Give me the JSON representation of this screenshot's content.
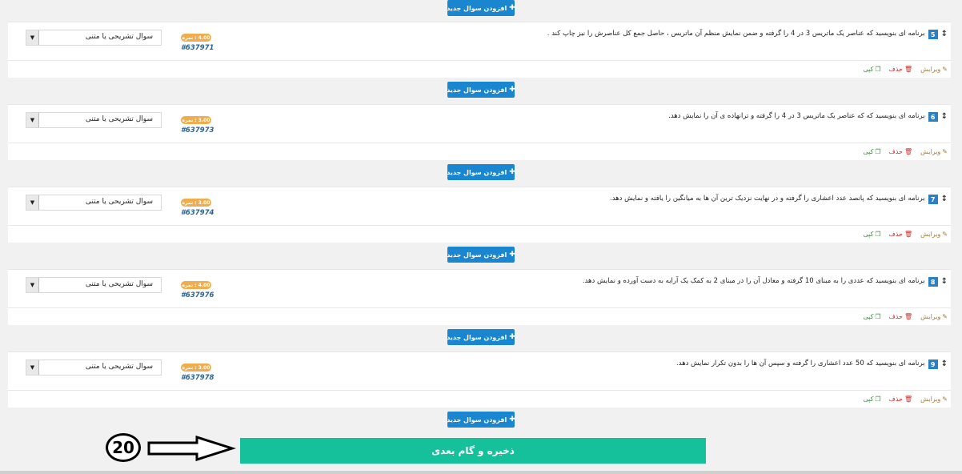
{
  "add_button_label": "افزودن سوال جدید",
  "questions": [
    {
      "number": "5",
      "text": "برنامه ای بنویسید که عناصر یک ماتریس 3 در 4 را گرفته و ضمن نمایش منظم آن ماتریس ، حاصل جمع کل عناصرش را نیز چاپ کند .",
      "score": "4.00 : نمره",
      "id": "#637971",
      "type": "سوال تشریحی یا متنی"
    },
    {
      "number": "6",
      "text": "برنامه ای بنویسید که که عناصر یک ماتریس 3 در 4 را گرفته و ترانهاده ی آن را نمایش دهد.",
      "score": "3.00 : نمره",
      "id": "#637973",
      "type": "سوال تشریحی یا متنی"
    },
    {
      "number": "7",
      "text": "برنامه ای بنویسید که پانصد عدد اعشاری را گرفته و در نهایت نزدیک ترین آن ها به میانگین را یافته و نمایش دهد.",
      "score": "3.00 : نمره",
      "id": "#637974",
      "type": "سوال تشریحی یا متنی"
    },
    {
      "number": "8",
      "text": "برنامه ای بنویسید که عددی را به مبنای 10 گرفته و معادل آن را در مبنای 2 به کمک یک آرایه به دست آورده و نمایش دهد.",
      "score": "4.00 : نمره",
      "id": "#637976",
      "type": "سوال تشریحی یا متنی"
    },
    {
      "number": "9",
      "text": "برنامه ای بنویسید که 50 عدد اعشاری را گرفته و سپس آن ها را بدون تکرار نمایش دهد.",
      "score": "3.00 : نمره",
      "id": "#637978",
      "type": "سوال تشریحی یا متنی"
    }
  ],
  "actions": {
    "edit": "ویرایش",
    "delete": "حذف",
    "copy": "کپی"
  },
  "save_button_label": "ذخیره و گام بعدی",
  "annotation_number": "20"
}
